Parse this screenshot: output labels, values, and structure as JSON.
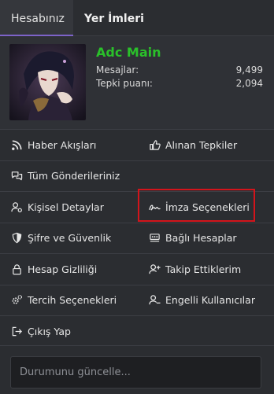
{
  "tabs": {
    "account": "Hesabınız",
    "bookmarks": "Yer İmleri"
  },
  "profile": {
    "username": "Adc Main",
    "messages_label": "Mesajlar:",
    "messages_value": "9,499",
    "reaction_label": "Tepki puanı:",
    "reaction_value": "2,094"
  },
  "menu": {
    "news_feed": "Haber Akışları",
    "received_reactions": "Alınan Tepkiler",
    "all_posts": "Tüm Gönderileriniz",
    "personal_details": "Kişisel Detaylar",
    "signature_options": "İmza Seçenekleri",
    "password_security": "Şifre ve Güvenlik",
    "connected_accounts": "Bağlı Hesaplar",
    "account_privacy": "Hesap Gizliliği",
    "following": "Takip Ettiklerim",
    "preferences": "Tercih Seçenekleri",
    "ignored_users": "Engelli Kullanıcılar",
    "logout": "Çıkış Yap"
  },
  "status": {
    "placeholder": "Durumunu güncelle..."
  },
  "colors": {
    "accent": "#7d63c8",
    "username": "#2ac12a",
    "highlight": "#d3141b"
  }
}
